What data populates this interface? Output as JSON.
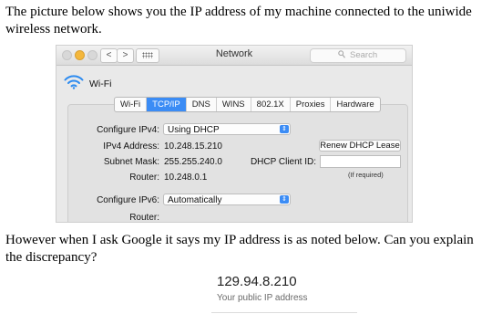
{
  "text": {
    "intro": "The picture below shows you the IP address of my machine connected to the uniwide wireless network.",
    "question": "However when I ask Google it says my IP address is as noted below. Can you explain the discrepancy?"
  },
  "window": {
    "title": "Network",
    "nav_back": "<",
    "nav_forward": ">",
    "search_placeholder": "Search",
    "interface_name": "Wi-Fi",
    "tabs": [
      "Wi-Fi",
      "TCP/IP",
      "DNS",
      "WINS",
      "802.1X",
      "Proxies",
      "Hardware"
    ],
    "active_tab": "TCP/IP",
    "configure_ipv4_label": "Configure IPv4:",
    "configure_ipv4_value": "Using DHCP",
    "ipv4_address_label": "IPv4 Address:",
    "ipv4_address": "10.248.15.210",
    "subnet_mask_label": "Subnet Mask:",
    "subnet_mask": "255.255.240.0",
    "router_label": "Router:",
    "router": "10.248.0.1",
    "renew_button": "Renew DHCP Lease",
    "dhcp_client_id_label": "DHCP Client ID:",
    "dhcp_client_id_value": "",
    "if_required": "(If required)",
    "configure_ipv6_label": "Configure IPv6:",
    "configure_ipv6_value": "Automatically",
    "router6_label": "Router:"
  },
  "public_ip": {
    "address": "129.94.8.210",
    "caption": "Your public IP address"
  },
  "icons": [
    "wifi-icon",
    "search-icon",
    "grid-icon",
    "chevron-updown-icon"
  ],
  "colors": {
    "accent": "#3b8cf5",
    "minimize_light": "#f4b73b"
  }
}
